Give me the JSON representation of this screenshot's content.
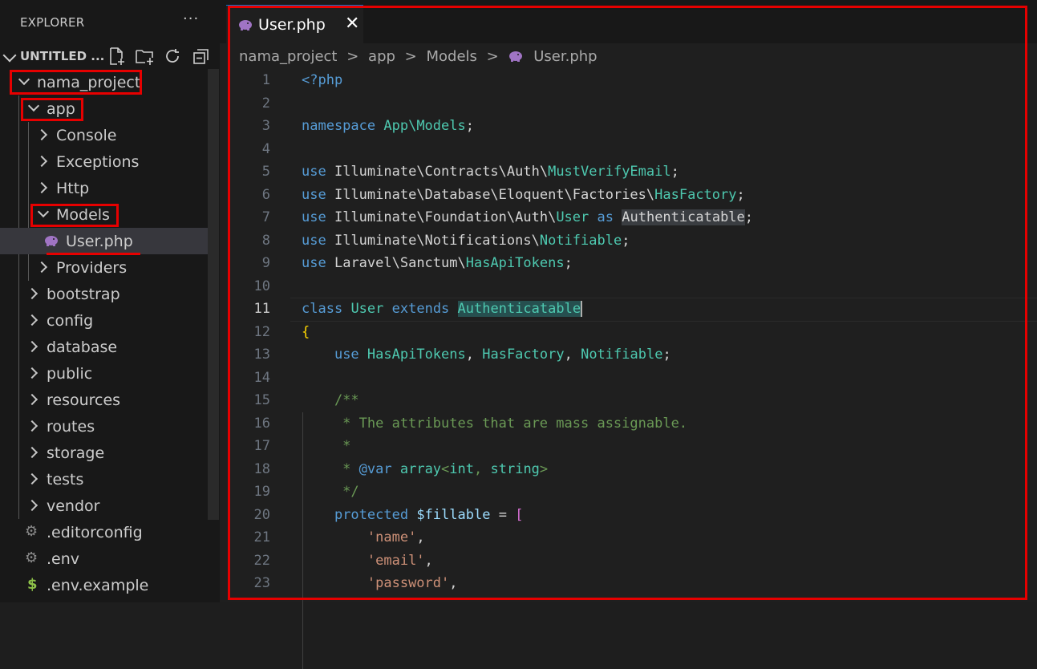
{
  "sidebar": {
    "title": "EXPLORER",
    "more": "···",
    "workspace": "UNTITLED ...",
    "actions": [
      "new-file-icon",
      "new-folder-icon",
      "refresh-icon",
      "collapse-all-icon"
    ],
    "items": [
      {
        "label": "nama_project",
        "type": "folder-open",
        "depth": 1
      },
      {
        "label": "app",
        "type": "folder-open",
        "depth": 2
      },
      {
        "label": "Console",
        "type": "folder",
        "depth": 3
      },
      {
        "label": "Exceptions",
        "type": "folder",
        "depth": 3
      },
      {
        "label": "Http",
        "type": "folder",
        "depth": 3
      },
      {
        "label": "Models",
        "type": "folder-open",
        "depth": 3
      },
      {
        "label": "User.php",
        "type": "php-file",
        "depth": 4,
        "selected": true
      },
      {
        "label": "Providers",
        "type": "folder",
        "depth": 3
      },
      {
        "label": "bootstrap",
        "type": "folder",
        "depth": 2
      },
      {
        "label": "config",
        "type": "folder",
        "depth": 2
      },
      {
        "label": "database",
        "type": "folder",
        "depth": 2
      },
      {
        "label": "public",
        "type": "folder",
        "depth": 2
      },
      {
        "label": "resources",
        "type": "folder",
        "depth": 2
      },
      {
        "label": "routes",
        "type": "folder",
        "depth": 2
      },
      {
        "label": "storage",
        "type": "folder",
        "depth": 2
      },
      {
        "label": "tests",
        "type": "folder",
        "depth": 2
      },
      {
        "label": "vendor",
        "type": "folder",
        "depth": 2
      },
      {
        "label": ".editorconfig",
        "type": "gear-file",
        "depth": 2
      },
      {
        "label": ".env",
        "type": "gear-file",
        "depth": 2
      },
      {
        "label": ".env.example",
        "type": "dollar-file",
        "depth": 2
      }
    ]
  },
  "editor": {
    "tab": {
      "label": "User.php",
      "close": "✕"
    },
    "breadcrumb": [
      "nama_project",
      ">",
      "app",
      ">",
      "Models",
      ">",
      "User.php"
    ],
    "current_line": 11,
    "lines": [
      {
        "n": "1",
        "t": "<?php"
      },
      {
        "n": "2",
        "t": ""
      },
      {
        "n": "3",
        "t": "namespace App\\Models;"
      },
      {
        "n": "4",
        "t": ""
      },
      {
        "n": "5",
        "t": "use Illuminate\\Contracts\\Auth\\MustVerifyEmail;"
      },
      {
        "n": "6",
        "t": "use Illuminate\\Database\\Eloquent\\Factories\\HasFactory;"
      },
      {
        "n": "7",
        "t": "use Illuminate\\Foundation\\Auth\\User as Authenticatable;"
      },
      {
        "n": "8",
        "t": "use Illuminate\\Notifications\\Notifiable;"
      },
      {
        "n": "9",
        "t": "use Laravel\\Sanctum\\HasApiTokens;"
      },
      {
        "n": "10",
        "t": ""
      },
      {
        "n": "11",
        "t": "class User extends Authenticatable"
      },
      {
        "n": "12",
        "t": "{"
      },
      {
        "n": "13",
        "t": "    use HasApiTokens, HasFactory, Notifiable;"
      },
      {
        "n": "14",
        "t": ""
      },
      {
        "n": "15",
        "t": "    /**"
      },
      {
        "n": "16",
        "t": "     * The attributes that are mass assignable."
      },
      {
        "n": "17",
        "t": "     *"
      },
      {
        "n": "18",
        "t": "     * @var array<int, string>"
      },
      {
        "n": "19",
        "t": "     */"
      },
      {
        "n": "20",
        "t": "    protected $fillable = ["
      },
      {
        "n": "21",
        "t": "        'name',"
      },
      {
        "n": "22",
        "t": "        'email',"
      },
      {
        "n": "23",
        "t": "        'password',"
      }
    ]
  }
}
